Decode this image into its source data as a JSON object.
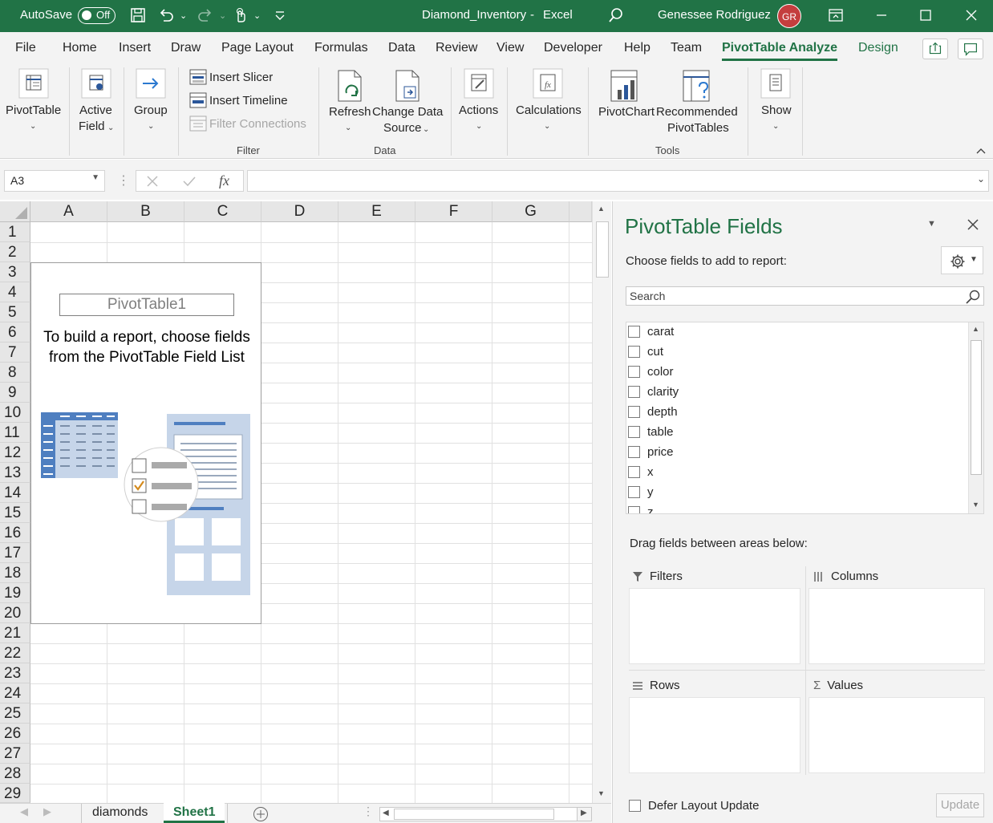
{
  "titlebar": {
    "autosave_label": "AutoSave",
    "autosave_state": "Off",
    "doc_title": "Diamond_Inventory",
    "separator": "-",
    "app_name": "Excel",
    "user_name": "Genessee Rodriguez",
    "user_initials": "GR",
    "accent_color": "#217346"
  },
  "tabs": [
    {
      "label": "File"
    },
    {
      "label": "Home"
    },
    {
      "label": "Insert"
    },
    {
      "label": "Draw"
    },
    {
      "label": "Page Layout"
    },
    {
      "label": "Formulas"
    },
    {
      "label": "Data"
    },
    {
      "label": "Review"
    },
    {
      "label": "View"
    },
    {
      "label": "Developer"
    },
    {
      "label": "Help"
    },
    {
      "label": "Team"
    },
    {
      "label": "PivotTable Analyze"
    },
    {
      "label": "Design"
    }
  ],
  "ribbon": {
    "pivottable": "PivotTable",
    "active_field_1": "Active",
    "active_field_2": "Field",
    "group": "Group",
    "insert_slicer": "Insert Slicer",
    "insert_timeline": "Insert Timeline",
    "filter_connections": "Filter Connections",
    "filter_group": "Filter",
    "refresh": "Refresh",
    "change_data_1": "Change Data",
    "change_data_2": "Source",
    "data_group": "Data",
    "actions": "Actions",
    "calculations": "Calculations",
    "pivotchart": "PivotChart",
    "recommended_1": "Recommended",
    "recommended_2": "PivotTables",
    "tools_group": "Tools",
    "show": "Show"
  },
  "formula_bar": {
    "name_box": "A3",
    "fx": "fx",
    "formula": ""
  },
  "grid": {
    "columns": [
      "A",
      "B",
      "C",
      "D",
      "E",
      "F",
      "G"
    ],
    "rows": [
      "1",
      "2",
      "3",
      "4",
      "5",
      "6",
      "7",
      "8",
      "9",
      "10",
      "11",
      "12",
      "13",
      "14",
      "15",
      "16",
      "17",
      "18",
      "19",
      "20",
      "21",
      "22",
      "23",
      "24",
      "25",
      "26",
      "27",
      "28",
      "29"
    ]
  },
  "pivot_placeholder": {
    "name": "PivotTable1",
    "line1": "To build a report, choose fields",
    "line2": "from the PivotTable Field List"
  },
  "sheets": {
    "tab1": "diamonds",
    "tab2": "Sheet1",
    "active": "Sheet1"
  },
  "panel": {
    "title": "PivotTable Fields",
    "subtitle": "Choose fields to add to report:",
    "search_placeholder": "Search",
    "fields": [
      {
        "label": "carat"
      },
      {
        "label": "cut"
      },
      {
        "label": "color"
      },
      {
        "label": "clarity"
      },
      {
        "label": "depth"
      },
      {
        "label": "table"
      },
      {
        "label": "price"
      },
      {
        "label": "x"
      },
      {
        "label": "y"
      },
      {
        "label": "z"
      }
    ],
    "drag_text": "Drag fields between areas below:",
    "filters": "Filters",
    "columns": "Columns",
    "rows": "Rows",
    "values": "Values",
    "defer": "Defer Layout Update",
    "update": "Update"
  }
}
